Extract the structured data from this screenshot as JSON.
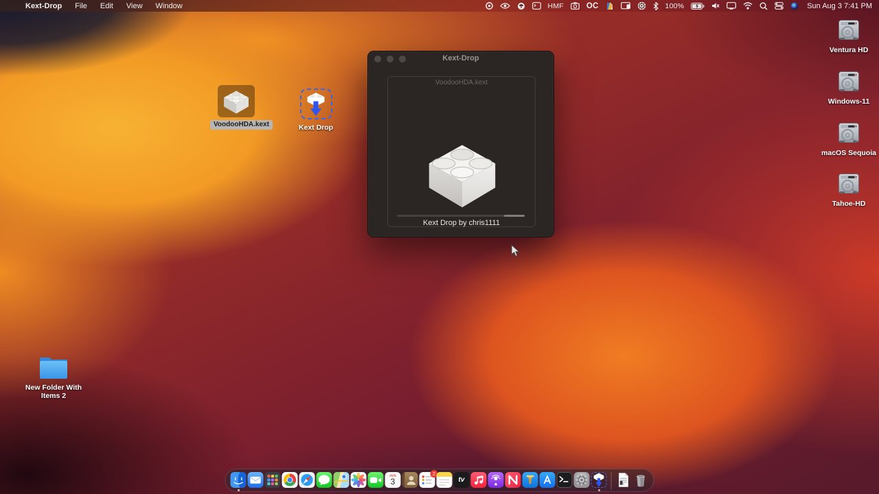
{
  "menu_bar": {
    "apple_icon": "",
    "items": [
      "Kext-Drop",
      "File",
      "Edit",
      "View",
      "Window"
    ],
    "status": {
      "hmf": "HMF ",
      "oc": "OC",
      "battery_percent": "100%",
      "clock": "Sun Aug 3  7:41 PM"
    },
    "status_icon_names": [
      "record-icon",
      "eye-icon",
      "app-circle-icon",
      "terminal-window-icon",
      "hmf-label",
      "camera-icon",
      "oc-label",
      "colored-app-icon",
      "sidecar-display-icon",
      "gear-circle-icon",
      "bluetooth-icon",
      "battery-percent",
      "battery-icon",
      "volume-muted-icon",
      "display-icon",
      "wifi-icon",
      "spotlight-icon",
      "control-center-icon",
      "siri-orb-icon",
      "clock"
    ]
  },
  "window": {
    "title": "Kext-Drop",
    "dropzone_label": "VoodooHDA.kext",
    "caption": "Kext Drop by chris1111",
    "progress": {
      "fill_start_pct": 84,
      "fill_end_pct": 100
    }
  },
  "desktop": {
    "files": [
      {
        "label": "VoodooHDA.kext",
        "state": "selected"
      },
      {
        "label": "Kext Drop",
        "state": "drop-target"
      }
    ],
    "drives": [
      {
        "label": "Ventura HD"
      },
      {
        "label": "Windows-11"
      },
      {
        "label": "macOS Sequoia"
      },
      {
        "label": "Tahoe-HD"
      }
    ],
    "folder_label": "New Folder With Items 2"
  },
  "dock": {
    "items": [
      {
        "name": "finder",
        "running": true
      },
      {
        "name": "mail"
      },
      {
        "name": "launchpad"
      },
      {
        "name": "chrome"
      },
      {
        "name": "safari"
      },
      {
        "name": "messages"
      },
      {
        "name": "maps"
      },
      {
        "name": "photos"
      },
      {
        "name": "facetime"
      },
      {
        "name": "calendar",
        "month": "AUG",
        "day": "3"
      },
      {
        "name": "contacts"
      },
      {
        "name": "reminders",
        "badge": "2"
      },
      {
        "name": "notes"
      },
      {
        "name": "tv",
        "glyph": "tv"
      },
      {
        "name": "music"
      },
      {
        "name": "podcasts"
      },
      {
        "name": "news"
      },
      {
        "name": "keynote"
      },
      {
        "name": "app-store"
      },
      {
        "name": "terminal"
      },
      {
        "name": "system-settings"
      },
      {
        "name": "kext-drop",
        "running": true,
        "selected": true
      },
      {
        "name": "document"
      },
      {
        "name": "trash"
      }
    ]
  },
  "colors": {
    "accent_blue": "#3f66e8",
    "window_bg": "#2b2623",
    "selected_label_bg": "#b9b5b2",
    "dock_indicator": "#ddc9c6"
  }
}
